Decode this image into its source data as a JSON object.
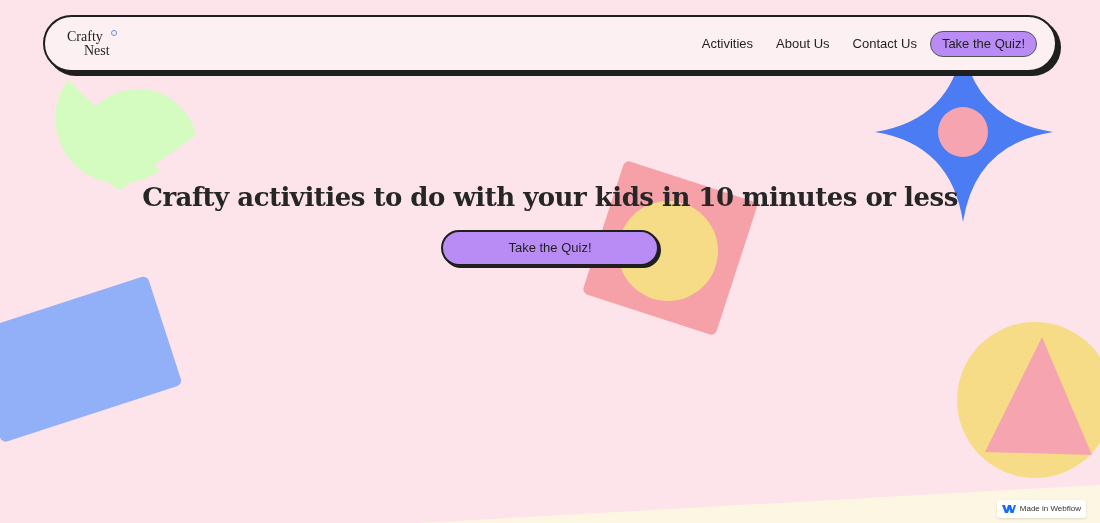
{
  "logo": {
    "line_1": "Crafty",
    "line_2": "Nest"
  },
  "nav": {
    "links": [
      "Activities",
      "About Us",
      "Contact Us"
    ],
    "cta": "Take the Quiz!"
  },
  "hero": {
    "heading": "Crafty activities to do with your kids in 10 minutes or less",
    "button": "Take the Quiz!"
  },
  "badge": {
    "label": "Made in Webflow"
  }
}
